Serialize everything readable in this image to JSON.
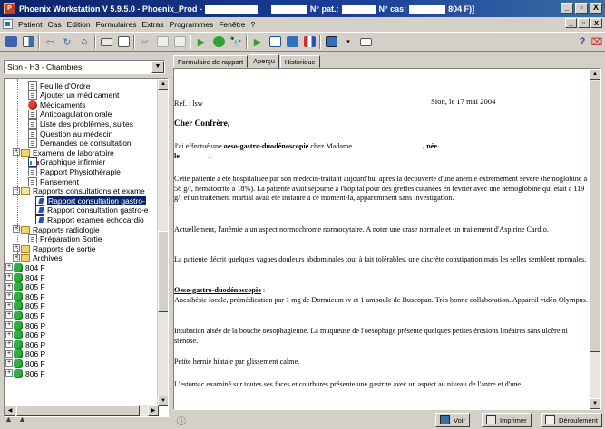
{
  "window": {
    "title_app": "Phoenix Workstation V 5.9.5.0 - Phoenix_Prod - ",
    "title_patient_label": "N° pat.:",
    "title_case_label": "N° cas:",
    "title_room": "804 F)]",
    "btn_min": "_",
    "btn_max": "▫",
    "btn_close": "X"
  },
  "menu": {
    "items": [
      "Patient",
      "Cas",
      "Edition",
      "Formulaires",
      "Extras",
      "Programmes",
      "Fenêtre",
      "?"
    ],
    "right_btns": [
      "_",
      "▫",
      "x"
    ]
  },
  "toolbar": {
    "icons": [
      "save-icon",
      "layout-icon",
      "back-icon",
      "forward-icon",
      "home-icon",
      "print-icon",
      "preview-icon",
      "cut-icon",
      "copy-icon",
      "paste-icon",
      "play-icon",
      "record-icon",
      "find-icon",
      "flag-icon",
      "window-icon",
      "grid-icon",
      "chart-icon",
      "screen-icon",
      "mail-icon"
    ],
    "right_icons": [
      "help-icon",
      "exit-icon"
    ]
  },
  "left": {
    "combo_value": "Sion - H3 - Chambres",
    "tree": [
      {
        "label": "Feuille d'Ordre",
        "icon": "doc"
      },
      {
        "label": "Ajouter un médicament",
        "icon": "doc"
      },
      {
        "label": "Médicaments",
        "icon": "pill"
      },
      {
        "label": "Anticoagulation orale",
        "icon": "doc"
      },
      {
        "label": "Liste des problèmes, suites",
        "icon": "doc"
      },
      {
        "label": "Question au médecin",
        "icon": "doc"
      },
      {
        "label": "Demandes de consultation",
        "icon": "doc"
      },
      {
        "label": "Examens de laboratoire",
        "icon": "folder"
      },
      {
        "label": "Graphique infirmier",
        "icon": "chart"
      },
      {
        "label": "Rapport Physiothérapie",
        "icon": "doc"
      },
      {
        "label": "Pansement",
        "icon": "doc"
      },
      {
        "label": "Rapports consultations et exame",
        "icon": "folder-open"
      },
      {
        "label": "Rapport consultation gastro-",
        "icon": "report"
      },
      {
        "label": "Rapport consultation gastro-e",
        "icon": "report"
      },
      {
        "label": "Rapport examen echocardio",
        "icon": "report"
      },
      {
        "label": "Rapports radiologie",
        "icon": "folder"
      },
      {
        "label": "Préparation Sortie",
        "icon": "doc"
      },
      {
        "label": "Rapports de sortie",
        "icon": "folder"
      },
      {
        "label": "Archives",
        "icon": "folder"
      },
      {
        "label": "804 F",
        "icon": "patient"
      },
      {
        "label": "804 F",
        "icon": "patient"
      },
      {
        "label": "805 F",
        "icon": "patient"
      },
      {
        "label": "805 F",
        "icon": "patient"
      },
      {
        "label": "805 F",
        "icon": "patient"
      },
      {
        "label": "805 F",
        "icon": "patient"
      },
      {
        "label": "806 P",
        "icon": "patient"
      },
      {
        "label": "806 P",
        "icon": "patient"
      },
      {
        "label": "806 P",
        "icon": "patient"
      },
      {
        "label": "806 P",
        "icon": "patient"
      },
      {
        "label": "806 F",
        "icon": "patient"
      },
      {
        "label": "806 F",
        "icon": "patient"
      }
    ]
  },
  "tabs": [
    "Formulaire de rapport",
    "Aperçu",
    "Historique"
  ],
  "document": {
    "ref": "Réf. : lsw",
    "place_date": "Sion, le 17 mai 2004",
    "salutation": "Cher Confrère,",
    "intro_a": "J'ai effectué une ",
    "intro_bold": "oeso-gastro-duodénoscopie",
    "intro_b": " chez Madame",
    "intro_nee": ", née",
    "intro_le": "le",
    "p1": "Cette patiente a été hospitalisée par son médecin-traitant aujourd'hui après la découverte d'une anémie extrêmement sévère (hémoglobine à 58 g/l, hématocrite à 18%). La patiente avait séjourné à l'hôpital pour des greffes cutanées en février avec une hémoglobine qui était à 119 g/l et un traitement martial avait été instauré à ce moment-là, apparemment sans investigation.",
    "p2": "Actuellement, l'anémie a un aspect normochrome normocytaire. A noter une crase normale et un traitement d'Aspirine Cardio.",
    "p3": "La patiente décrit quelques vagues douleurs abdominales tout à fait tolérables, une discrète constipation mais les selles semblent normales.",
    "section_title": "Oeso-gastro-duodénoscopie",
    "section_colon": " :",
    "p4": "Anesthésie locale, prémédication par 1 mg de Dormicum iv et 1 ampoule de Buscopan. Très bonne collaboration. Appareil vidéo Olympus.",
    "p5": "Intubation aisée de la bouche oesophagienne. La muqueuse de l'oesophage présente quelques petites érosions linéaires sans ulcère ni sténose.",
    "p6": "Petite hernie hiatale par glissement calme.",
    "p7": "L'estomac examiné sur toutes ses faces et courbures présente une gastrite avec un aspect au niveau de l'antre et d'une"
  },
  "bottom": {
    "voir": "Voir",
    "imprimer": "Imprimer",
    "deroulement": "Déroulement"
  }
}
